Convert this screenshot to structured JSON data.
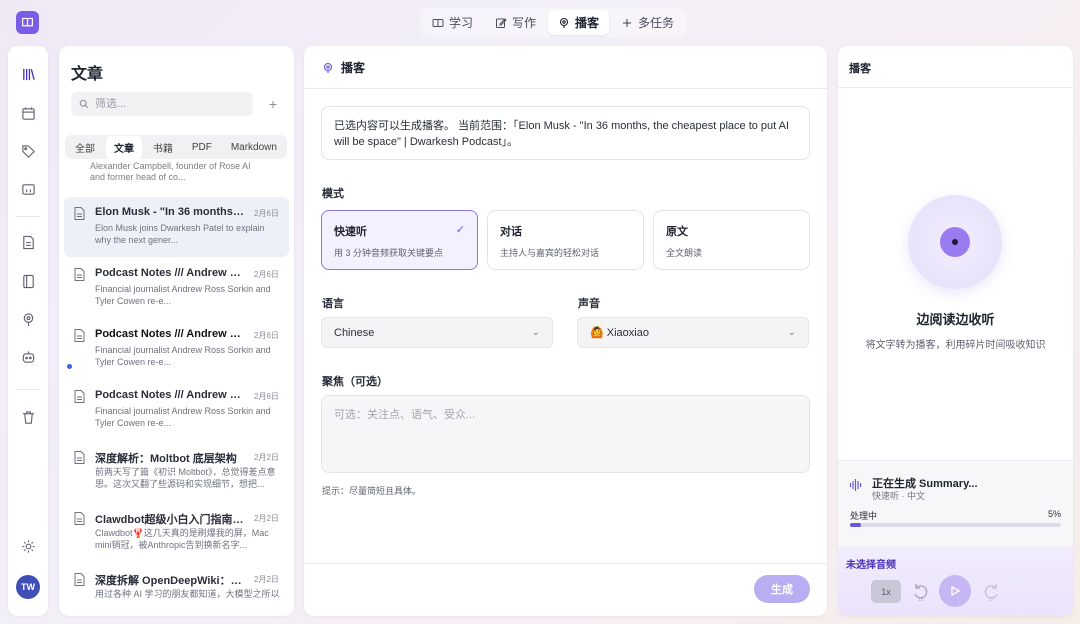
{
  "colors": {
    "accent": "#6a55d8",
    "accent_light": "#b9aef2",
    "avatar": "#3f4fb5",
    "unread_dot": "#3b63d9"
  },
  "topnav": [
    {
      "label": "学习",
      "icon": "book-icon",
      "active": false
    },
    {
      "label": "写作",
      "icon": "pen-icon",
      "active": false
    },
    {
      "label": "播客",
      "icon": "podcast-icon",
      "active": true
    },
    {
      "label": "多任务",
      "icon": "plus-icon",
      "active": false
    }
  ],
  "rail": {
    "avatar": "TW"
  },
  "list": {
    "title": "文章",
    "search_placeholder": "筛选...",
    "add": "+",
    "filters": [
      "全部",
      "文章",
      "书籍",
      "PDF",
      "Markdown"
    ],
    "partial_excerpt": "Alexander Campbell, founder of Rose AI and former head of co...",
    "items": [
      {
        "title": "Elon Musk - \"In 36 months, t...",
        "date": "2月6日",
        "excerpt": "Elon Musk joins Dwarkesh Patel to explain why the next gener...",
        "selected": true,
        "unread": false
      },
      {
        "title": "Podcast Notes /// Andrew Ro...",
        "date": "2月6日",
        "excerpt": "Financial journalist Andrew Ross Sorkin and Tyler Cowen re-e...",
        "selected": false,
        "unread": false
      },
      {
        "title": "Podcast Notes /// Andrew R...",
        "date": "2月6日",
        "excerpt": "Financial journalist Andrew Ross Sorkin and Tyler Cowen re-e...",
        "selected": false,
        "unread": true
      },
      {
        "title": "Podcast Notes /// Andrew Ro...",
        "date": "2月6日",
        "excerpt": "Financial journalist Andrew Ross Sorkin and Tyler Cowen re-e...",
        "selected": false,
        "unread": false
      },
      {
        "title": "深度解析：Moltbot 底层架构",
        "date": "2月2日",
        "excerpt": "前两天写了篇《初识 Moltbot》，总觉得差点意思。这次又翻了些源码和实现细节，想把...",
        "selected": false,
        "unread": false
      },
      {
        "title": "Clawdbot超级小白入门指南，...",
        "date": "2月2日",
        "excerpt": "Clawdbot🦞这几天真的是刷爆我的屏，Mac mini销冠，被Anthropic告到换新名字...",
        "selected": false,
        "unread": false
      },
      {
        "title": "深度拆解 OpenDeepWiki：如...",
        "date": "2月2日",
        "excerpt": "用过各种 AI 学习的朋友都知道，大模型之所以",
        "selected": false,
        "unread": false
      }
    ]
  },
  "main": {
    "header": "播客",
    "scope": "已选内容可以生成播客。 当前范围：「Elon Musk - \"In 36 months, the cheapest place to put AI will be space\" | Dwarkesh Podcast」。",
    "mode_label": "模式",
    "modes": [
      {
        "title": "快速听",
        "desc": "用 3 分钟音频获取关键要点",
        "selected": true
      },
      {
        "title": "对话",
        "desc": "主持人与嘉宾的轻松对话",
        "selected": false
      },
      {
        "title": "原文",
        "desc": "全文朗读",
        "selected": false
      }
    ],
    "language_label": "语言",
    "language_value": "Chinese",
    "voice_label": "声音",
    "voice_value": "🙆 Xiaoxiao",
    "focus_label": "聚焦（可选）",
    "focus_placeholder": "可选：关注点、语气、受众...",
    "hint": "提示：尽量简短且具体。",
    "generate": "生成"
  },
  "podcast": {
    "title": "播客",
    "blurb_title": "边阅读边收听",
    "blurb_sub": "将文字转为播客，利用碎片时间吸收知识",
    "gen_title": "正在生成 Summary...",
    "gen_sub": "快速听 · 中文",
    "progress_label": "处理中",
    "progress_pct": "5%",
    "progress": 0.05,
    "now_playing": "未选择音频",
    "speed": "1x",
    "rewind": "15",
    "forward": "15"
  }
}
